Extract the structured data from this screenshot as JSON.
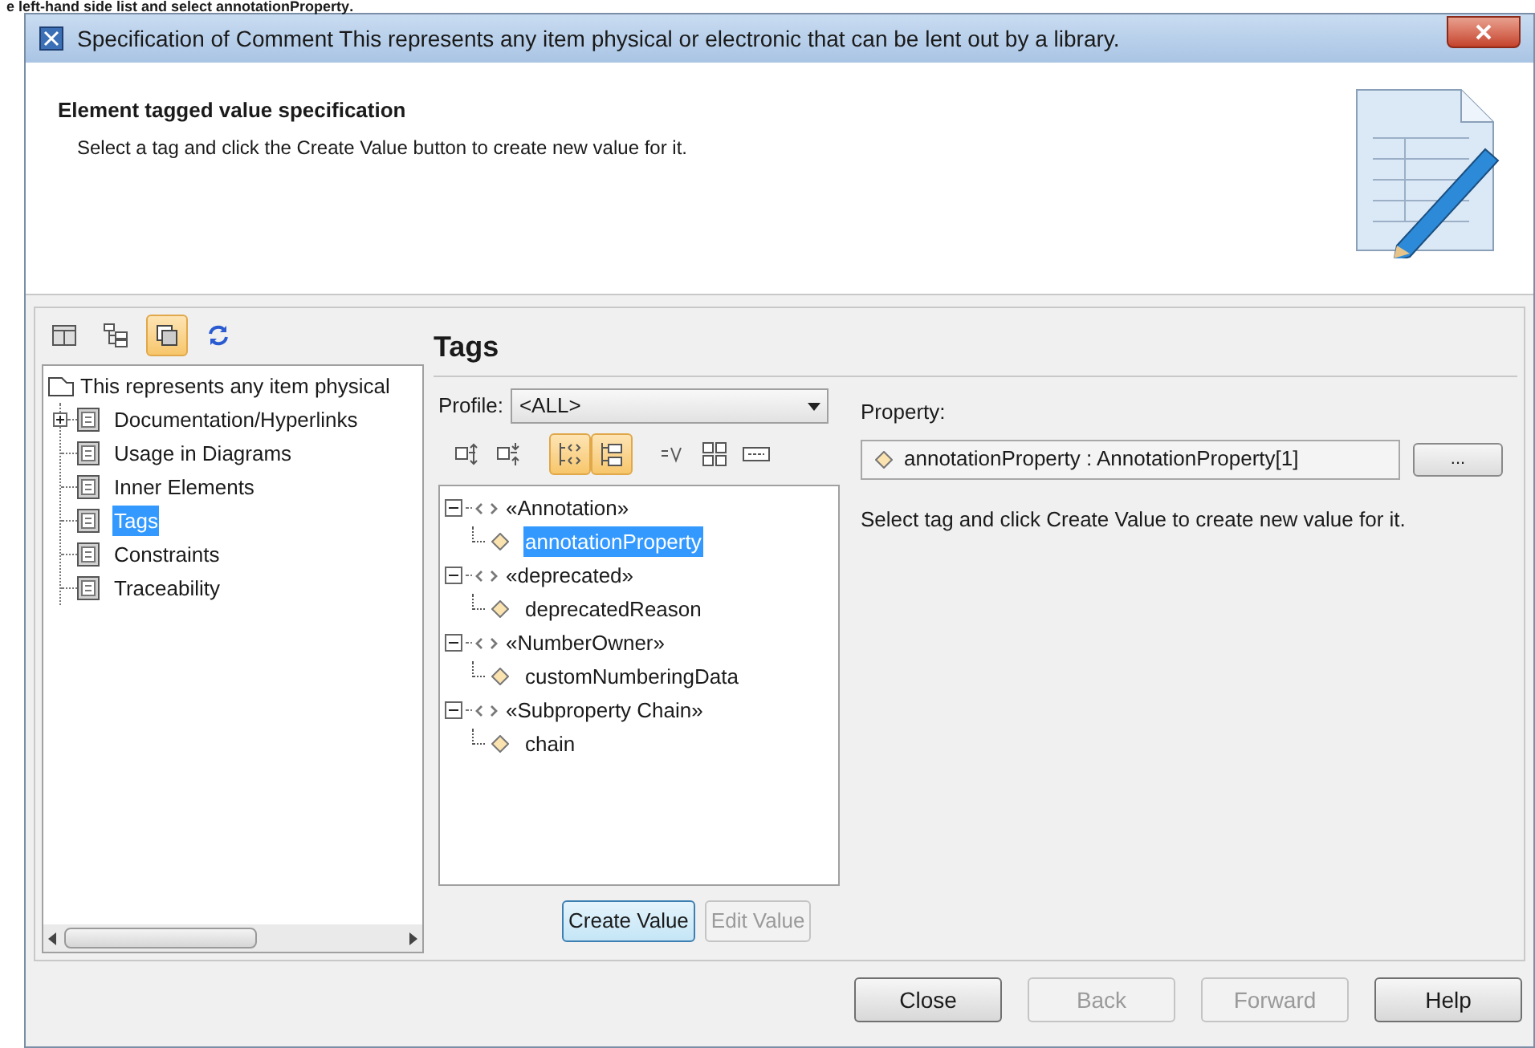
{
  "caption": "e left-hand side list and select **annotationProperty**.",
  "window": {
    "title": "Specification of Comment This represents any item physical or electronic that can be lent out by a library."
  },
  "header": {
    "title": "Element tagged value specification",
    "subtitle": "Select a tag and click the Create Value button to create new value for it."
  },
  "left_toolbar": [
    {
      "kind": "table",
      "on": false
    },
    {
      "kind": "tree",
      "on": false
    },
    {
      "kind": "copy",
      "on": true
    },
    {
      "kind": "refresh",
      "on": false
    }
  ],
  "nav_tree": {
    "label": "This represents any item physical",
    "children": [
      {
        "label": "Documentation/Hyperlinks",
        "expanded": false,
        "selected": false
      },
      {
        "label": "Usage in Diagrams",
        "selected": false
      },
      {
        "label": "Inner Elements",
        "selected": false
      },
      {
        "label": "Tags",
        "selected": true
      },
      {
        "label": "Constraints",
        "selected": false
      },
      {
        "label": "Traceability",
        "selected": false
      }
    ]
  },
  "panel": {
    "title": "Tags",
    "profile_label": "Profile:",
    "profile_value": "<ALL>",
    "toolbar": [
      {
        "kind": "expand",
        "on": false
      },
      {
        "kind": "collapse",
        "on": false
      },
      {
        "kind": "stereotype",
        "on": true
      },
      {
        "kind": "group",
        "on": true
      },
      {
        "kind": "value",
        "on": false
      },
      {
        "kind": "grid",
        "on": false
      },
      {
        "kind": "field",
        "on": false
      }
    ],
    "tags": [
      {
        "label": "«Annotation»",
        "expanded": true,
        "children": [
          {
            "label": "annotationProperty",
            "selected": true
          }
        ]
      },
      {
        "label": "«deprecated»",
        "expanded": true,
        "children": [
          {
            "label": "deprecatedReason",
            "selected": false
          }
        ]
      },
      {
        "label": "«NumberOwner»",
        "expanded": true,
        "children": [
          {
            "label": "customNumberingData",
            "selected": false
          }
        ]
      },
      {
        "label": "«Subproperty Chain»",
        "expanded": true,
        "children": [
          {
            "label": "chain",
            "selected": false
          }
        ]
      }
    ],
    "buttons": [
      {
        "label": "Create Value",
        "disabled": false,
        "hover": true
      },
      {
        "label": "Edit Value",
        "disabled": true,
        "hover": false
      }
    ]
  },
  "property": {
    "label": "Property:",
    "value": "annotationProperty : AnnotationProperty[1]",
    "browse": "...",
    "message": "Select tag and click Create Value to create new value for it."
  },
  "footer_buttons": [
    {
      "label": "Close",
      "disabled": false
    },
    {
      "label": "Back",
      "disabled": true
    },
    {
      "label": "Forward",
      "disabled": true
    },
    {
      "label": "Help",
      "disabled": false
    }
  ]
}
